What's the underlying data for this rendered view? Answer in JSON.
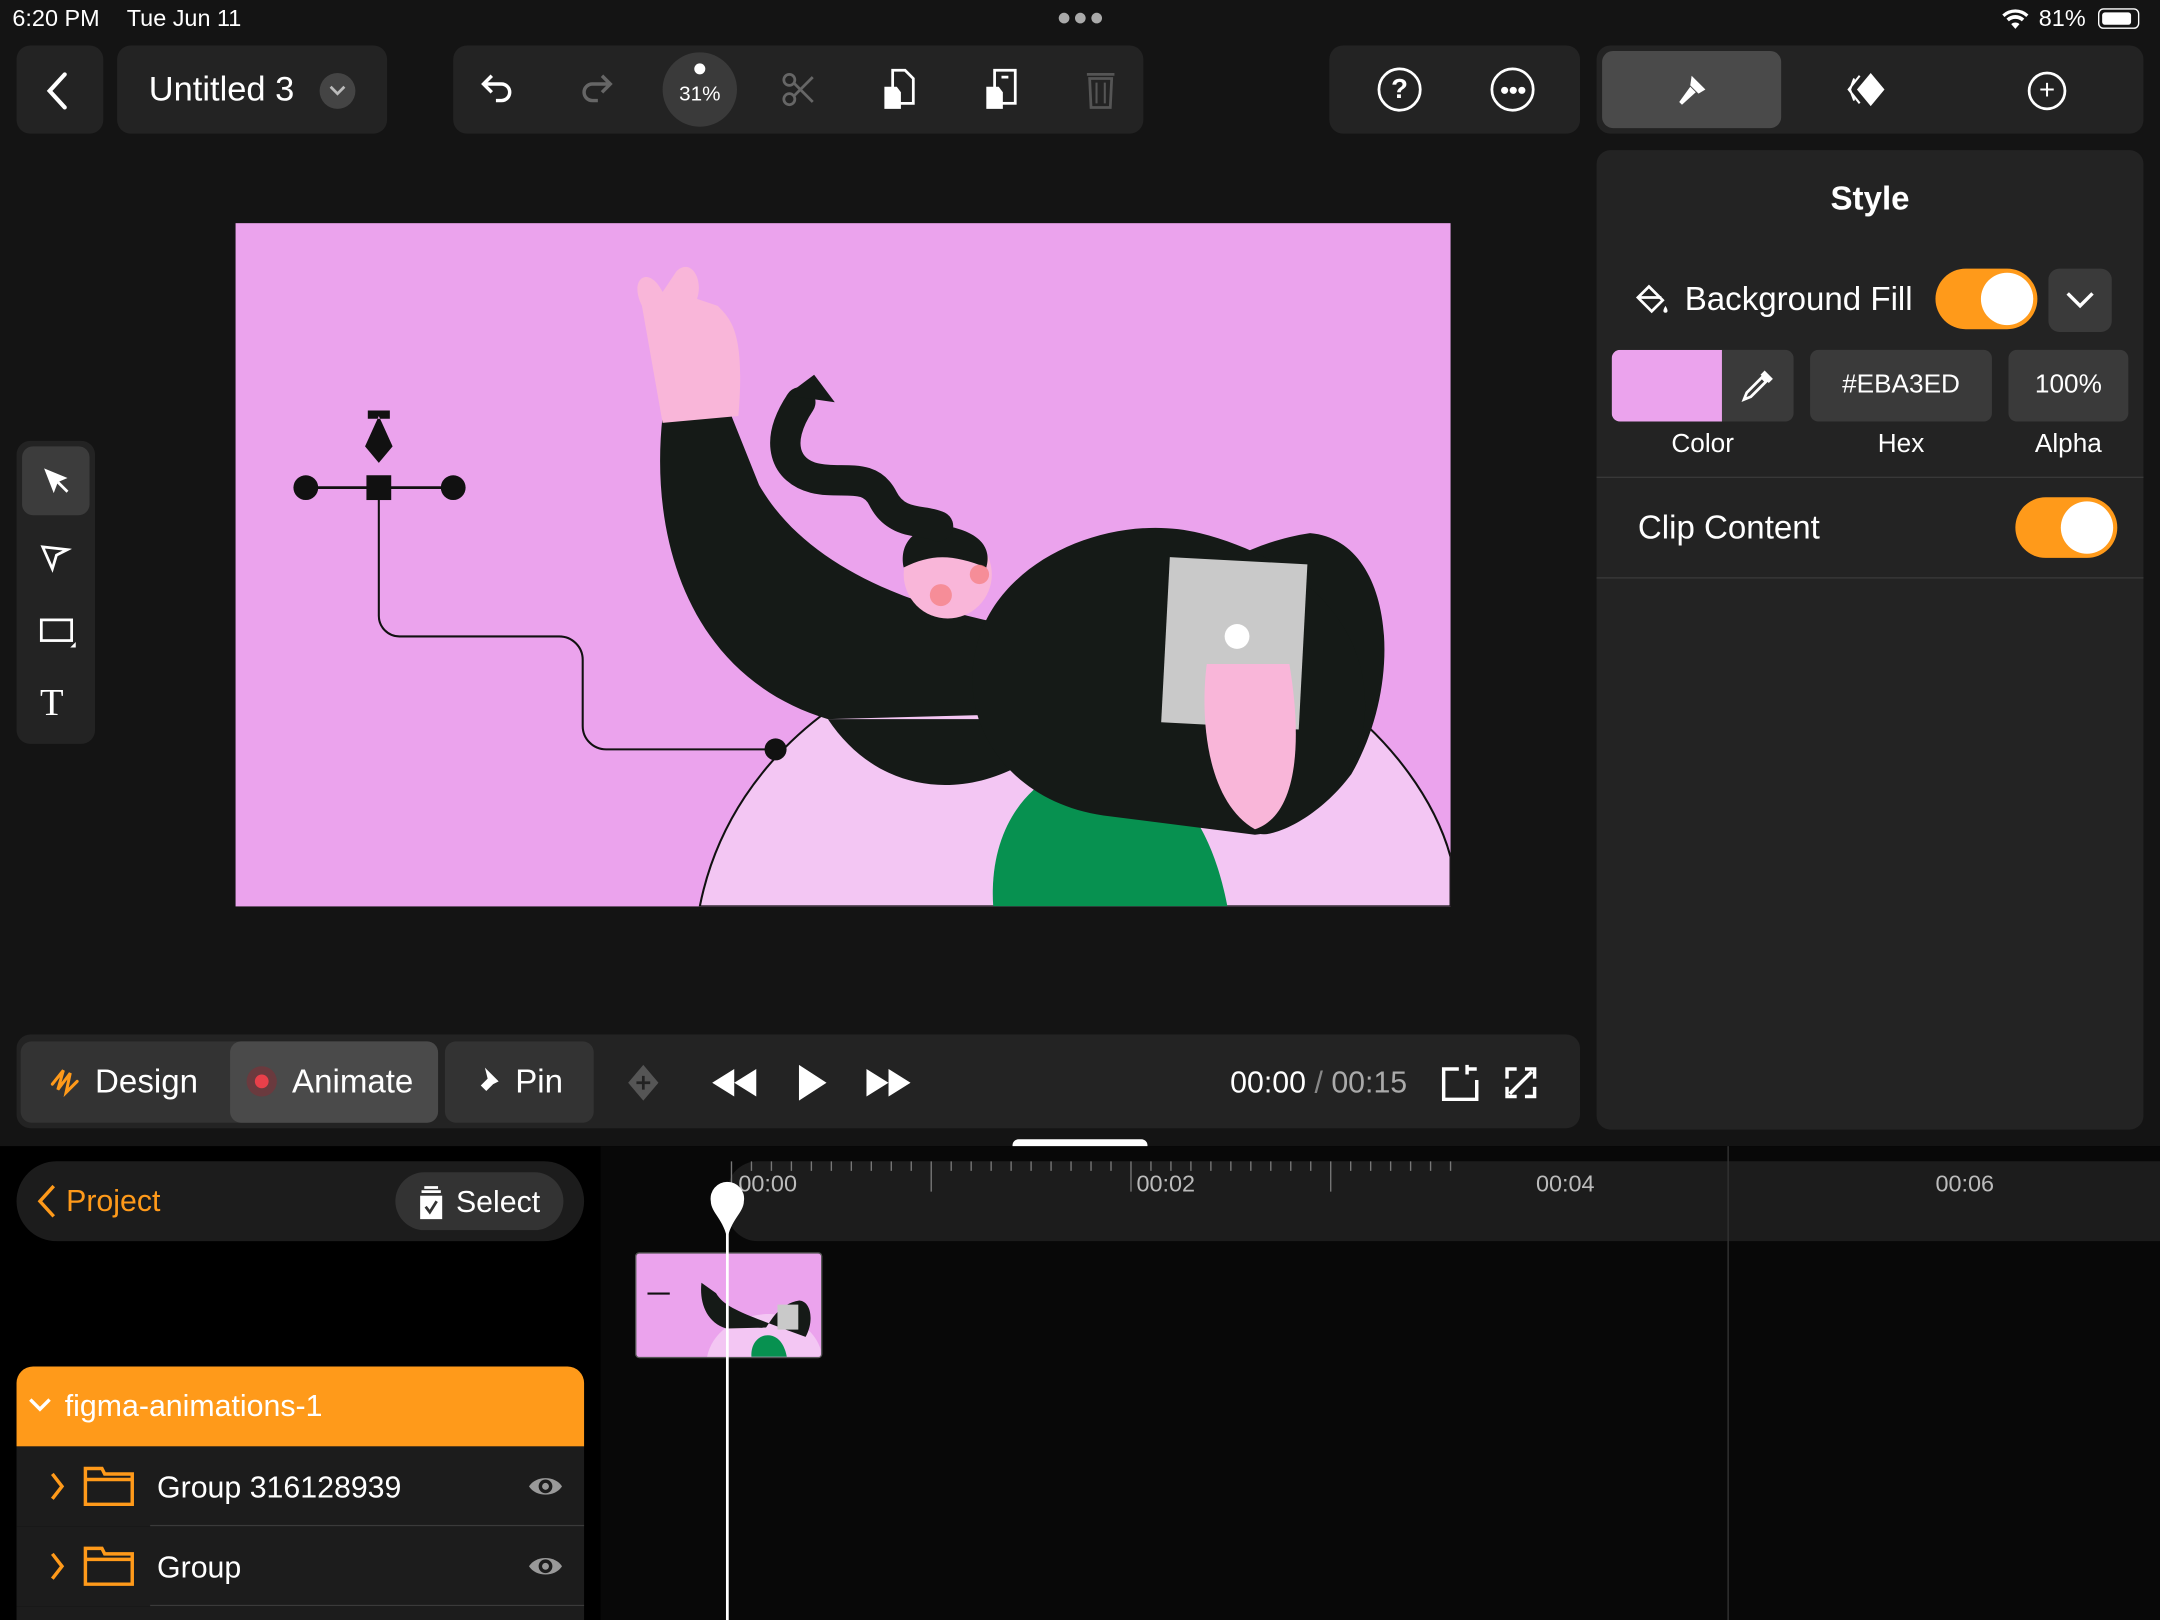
{
  "status_bar": {
    "time": "6:20 PM",
    "date": "Tue Jun 11",
    "battery": "81%"
  },
  "toolbar": {
    "title": "Untitled 3",
    "zoom": "31%"
  },
  "inspector": {
    "title": "Style",
    "background_fill_label": "Background Fill",
    "background_fill_on": true,
    "color_label": "Color",
    "hex_label": "Hex",
    "alpha_label": "Alpha",
    "hex_value": "#EBA3ED",
    "alpha_value": "100%",
    "clip_content_label": "Clip Content",
    "clip_content_on": true,
    "swatch_color": "#EBA3ED"
  },
  "playbar": {
    "design": "Design",
    "animate": "Animate",
    "pin": "Pin",
    "current_time": "00:00",
    "separator": "/",
    "total_time": "00:15"
  },
  "layers": {
    "back": "Project",
    "select": "Select",
    "root": "figma-animations-1",
    "items": [
      {
        "name": "Group 316128939"
      },
      {
        "name": "Group"
      }
    ]
  },
  "timeline": {
    "ticks": [
      "00:00",
      "00:02",
      "00:04",
      "00:06"
    ]
  },
  "colors": {
    "accent": "#FF9A1A",
    "canvas_bg": "#EBA3ED",
    "record": "#E8404A"
  }
}
